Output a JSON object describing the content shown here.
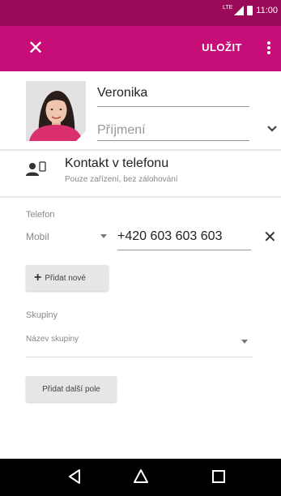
{
  "status_bar": {
    "network": "LTE",
    "time": "11:00"
  },
  "app_bar": {
    "close_icon": "close-icon",
    "save_label": "ULOŽIT",
    "menu_icon": "more-vert-icon"
  },
  "contact": {
    "first_name": "Veronika",
    "surname_placeholder": "Příjmení"
  },
  "account": {
    "icon": "contact-device-icon",
    "title": "Kontakt v telefonu",
    "subtitle": "Pouze zařízení, bez zálohování"
  },
  "phone": {
    "section_label": "Telefon",
    "type": "Mobil",
    "number": "+420 603 603 603"
  },
  "add_new_label": "Přidat nové",
  "groups": {
    "section_label": "Skupiny",
    "placeholder": "Název skupiny"
  },
  "add_field_label": "Přidat další pole",
  "colors": {
    "status_bar": "#9a0a59",
    "app_bar": "#c60d78"
  },
  "nav": {
    "back": "back-icon",
    "home": "home-icon",
    "recents": "recents-icon"
  }
}
